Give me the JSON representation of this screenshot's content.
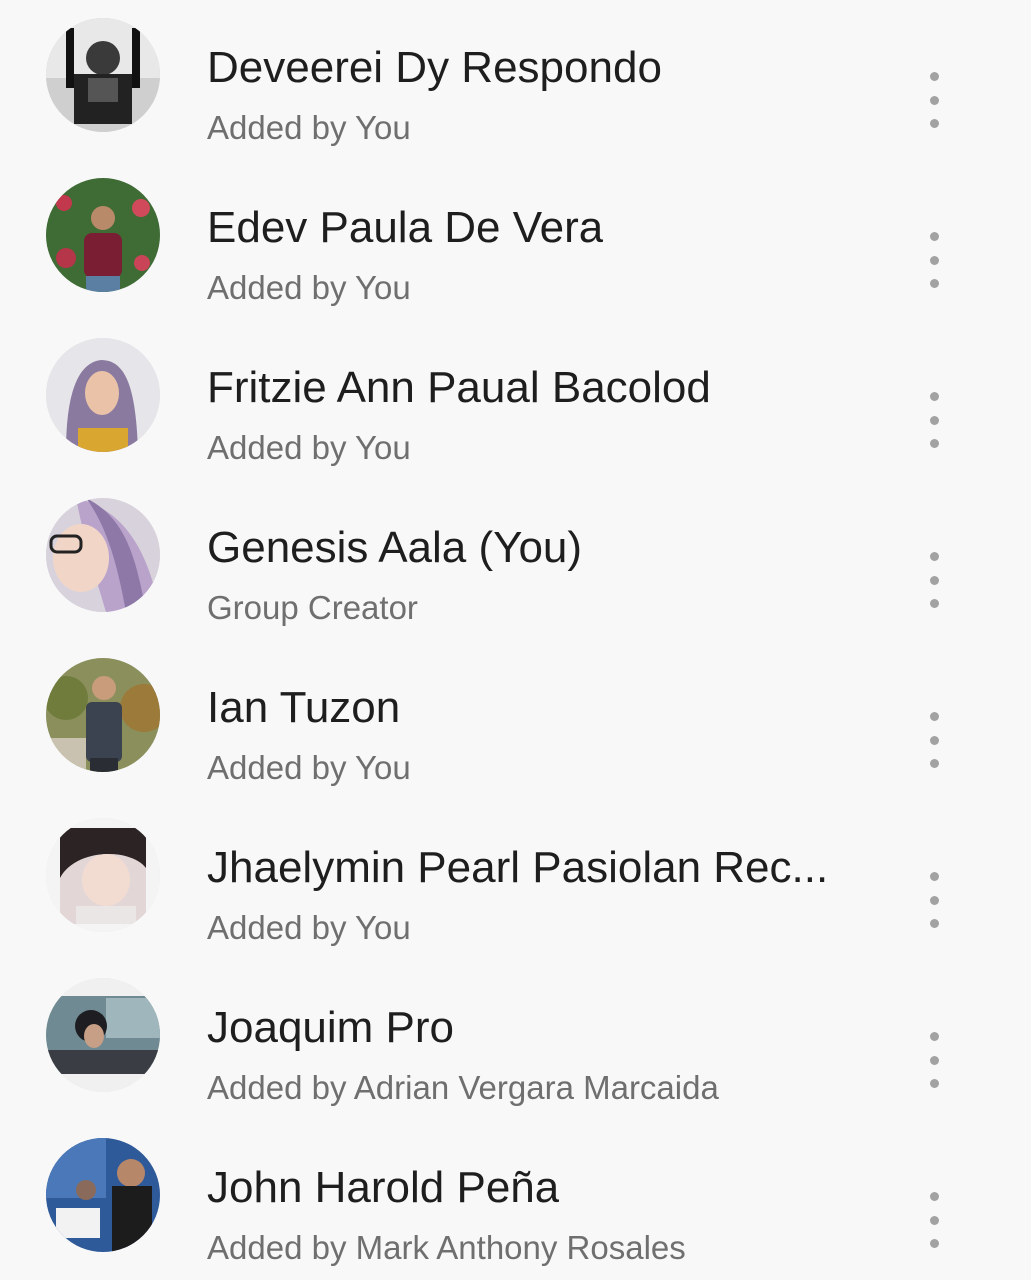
{
  "members": [
    {
      "name": "Deveerei Dy Respondo",
      "subtitle": "Added by You",
      "avatar_icon": "avatar-photo-icon"
    },
    {
      "name": "Edev Paula De Vera",
      "subtitle": "Added by You",
      "avatar_icon": "avatar-photo-icon"
    },
    {
      "name": "Fritzie Ann Paual Bacolod",
      "subtitle": "Added by You",
      "avatar_icon": "avatar-photo-icon"
    },
    {
      "name": "Genesis Aala (You)",
      "subtitle": "Group Creator",
      "avatar_icon": "avatar-photo-icon"
    },
    {
      "name": "Ian Tuzon",
      "subtitle": "Added by You",
      "avatar_icon": "avatar-photo-icon"
    },
    {
      "name": "Jhaelymin Pearl Pasiolan Rec...",
      "subtitle": "Added by You",
      "avatar_icon": "avatar-photo-icon"
    },
    {
      "name": "Joaquim Pro",
      "subtitle": "Added by Adrian Vergara Marcaida",
      "avatar_icon": "avatar-photo-icon"
    },
    {
      "name": "John Harold Peña",
      "subtitle": "Added by Mark Anthony Rosales",
      "avatar_icon": "avatar-photo-icon"
    }
  ],
  "more_icon": "more-vertical-icon",
  "colors": {
    "background": "#f8f8f8",
    "name_text": "#1e1e1e",
    "subtitle_text": "#6f6f6f",
    "more_dots": "#a2a2a2"
  }
}
